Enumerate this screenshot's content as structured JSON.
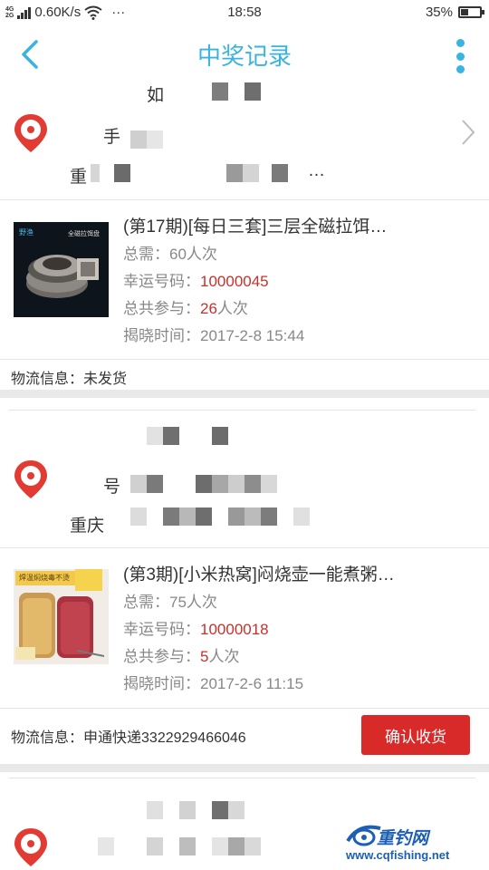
{
  "status_bar": {
    "network_top": "4G",
    "network_bottom": "2G",
    "speed": "0.60K/s",
    "wifi_icon": "wifi-icon",
    "dots": "···",
    "time": "18:58",
    "battery_percent": "35%"
  },
  "header": {
    "title": "中奖记录",
    "back_icon": "back-chevron-icon",
    "more_icon": "more-vertical-icon"
  },
  "colors": {
    "accent": "#39b3e0",
    "lucky_red": "#c8302c",
    "button_red": "#d92a2a"
  },
  "records": [
    {
      "address": {
        "name_line": "如",
        "phone_line": "手",
        "address_line": "重",
        "address_tail": "…"
      },
      "item": {
        "title": "(第17期)[每日三套]三层全磁拉饵…",
        "thumb_text_left": "野渔",
        "thumb_text_right": "全磁拉饵盘",
        "total_label": "总需：",
        "total_value": "60人次",
        "lucky_label": "幸运号码：",
        "lucky_value": "10000045",
        "participate_label": "总共参与：",
        "participate_value": "26",
        "participate_unit": "人次",
        "reveal_label": "揭晓时间：",
        "reveal_value": "2017-2-8 15:44"
      },
      "logistics_label": "物流信息：",
      "logistics_value": "未发货"
    },
    {
      "address": {
        "phone_line": "号",
        "address_line": "重庆"
      },
      "item": {
        "title": "(第3期)[小米热窝]闷烧壶一能煮粥…",
        "thumb_text": "焊温焖烧毒不烫",
        "total_label": "总需：",
        "total_value": "75人次",
        "lucky_label": "幸运号码：",
        "lucky_value": "10000018",
        "participate_label": "总共参与：",
        "participate_value": "5",
        "participate_unit": "人次",
        "reveal_label": "揭晓时间：",
        "reveal_value": "2017-2-6 11:15"
      },
      "logistics_label": "物流信息：",
      "logistics_value": "申通快递3322929466046",
      "confirm_button": "确认收货"
    }
  ],
  "watermark": {
    "brand": "重钓网",
    "url": "www.cqfishing.net"
  }
}
